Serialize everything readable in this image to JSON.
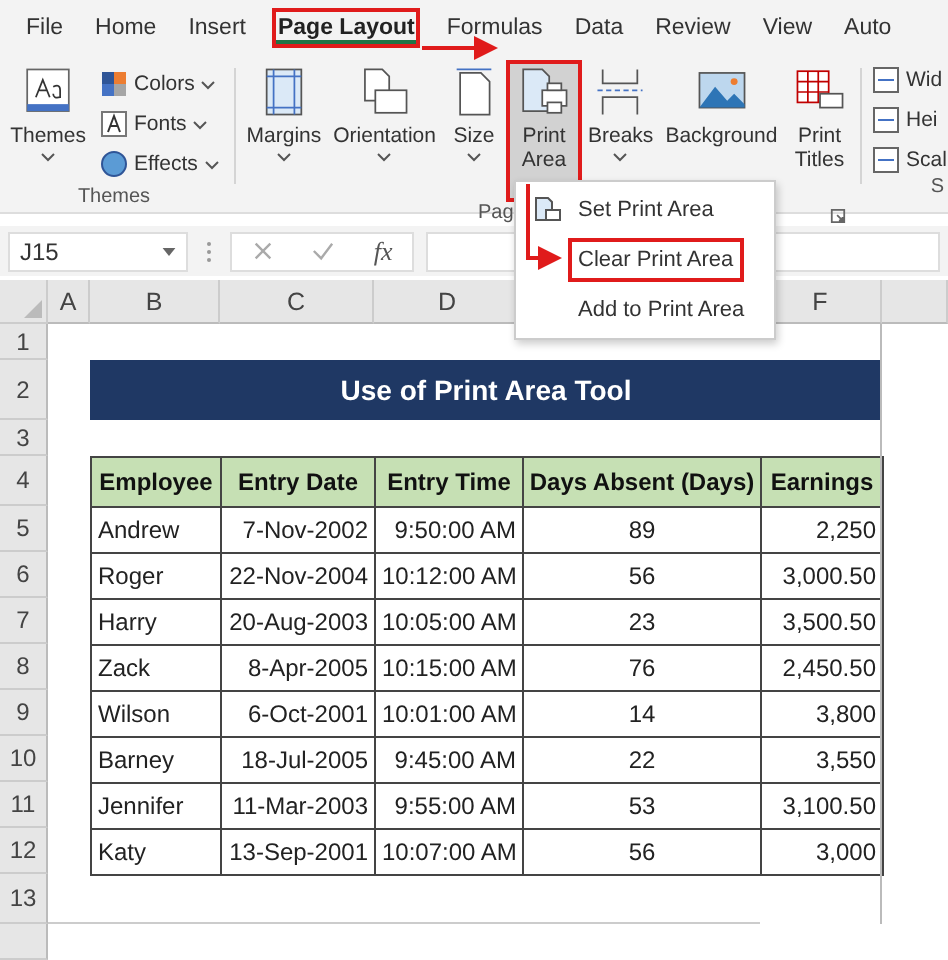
{
  "menu_tabs": [
    {
      "label": "File",
      "selected": false,
      "highlighted": false
    },
    {
      "label": "Home",
      "selected": false,
      "highlighted": false
    },
    {
      "label": "Insert",
      "selected": false,
      "highlighted": false
    },
    {
      "label": "Page Layout",
      "selected": true,
      "highlighted": true
    },
    {
      "label": "Formulas",
      "selected": false,
      "highlighted": false
    },
    {
      "label": "Data",
      "selected": false,
      "highlighted": false
    },
    {
      "label": "Review",
      "selected": false,
      "highlighted": false
    },
    {
      "label": "View",
      "selected": false,
      "highlighted": false
    },
    {
      "label": "Auto",
      "selected": false,
      "highlighted": false
    }
  ],
  "themes_group": {
    "big_button": "Themes",
    "items": [
      "Colors",
      "Fonts",
      "Effects"
    ],
    "label": "Themes"
  },
  "page_setup_group": {
    "buttons": [
      {
        "label": "Margins",
        "kind": "margins",
        "highlighted": false
      },
      {
        "label": "Orientation",
        "kind": "orientation",
        "highlighted": false
      },
      {
        "label": "Size",
        "kind": "size",
        "highlighted": false
      },
      {
        "label": "Print Area",
        "kind": "printarea",
        "highlighted": true
      },
      {
        "label": "Breaks",
        "kind": "breaks",
        "highlighted": false
      },
      {
        "label": "Background",
        "kind": "background",
        "highlighted": false
      },
      {
        "label": "Print Titles",
        "kind": "titles",
        "highlighted": false
      }
    ],
    "label": "Pag"
  },
  "scale_group": {
    "items": [
      "Wid",
      "Hei",
      "Scal"
    ],
    "label": "S"
  },
  "name_box": "J15",
  "formula_icon": "fx",
  "dropdown": {
    "items": [
      {
        "label": "Set Print Area",
        "icon": true,
        "highlighted": false
      },
      {
        "label": "Clear Print Area",
        "icon": false,
        "highlighted": true
      },
      {
        "label": "Add to Print Area",
        "icon": false,
        "highlighted": false
      }
    ]
  },
  "columns": [
    "A",
    "B",
    "C",
    "D",
    "F"
  ],
  "row_numbers": [
    "1",
    "2",
    "3",
    "4",
    "5",
    "6",
    "7",
    "8",
    "9",
    "10",
    "11",
    "12",
    "13"
  ],
  "sheet": {
    "title": "Use of Print Area Tool",
    "headers": [
      "Employee",
      "Entry Date",
      "Entry Time",
      "Days Absent (Days)",
      "Earnings"
    ],
    "rows": [
      [
        "Andrew",
        "7-Nov-2002",
        "9:50:00 AM",
        "89",
        "2,250"
      ],
      [
        "Roger",
        "22-Nov-2004",
        "10:12:00 AM",
        "56",
        "3,000.50"
      ],
      [
        "Harry",
        "20-Aug-2003",
        "10:05:00 AM",
        "23",
        "3,500.50"
      ],
      [
        "Zack",
        "8-Apr-2005",
        "10:15:00 AM",
        "76",
        "2,450.50"
      ],
      [
        "Wilson",
        "6-Oct-2001",
        "10:01:00 AM",
        "14",
        "3,800"
      ],
      [
        "Barney",
        "18-Jul-2005",
        "9:45:00 AM",
        "22",
        "3,550"
      ],
      [
        "Jennifer",
        "11-Mar-2003",
        "9:55:00 AM",
        "53",
        "3,100.50"
      ],
      [
        "Katy",
        "13-Sep-2001",
        "10:07:00 AM",
        "56",
        "3,000"
      ]
    ]
  }
}
